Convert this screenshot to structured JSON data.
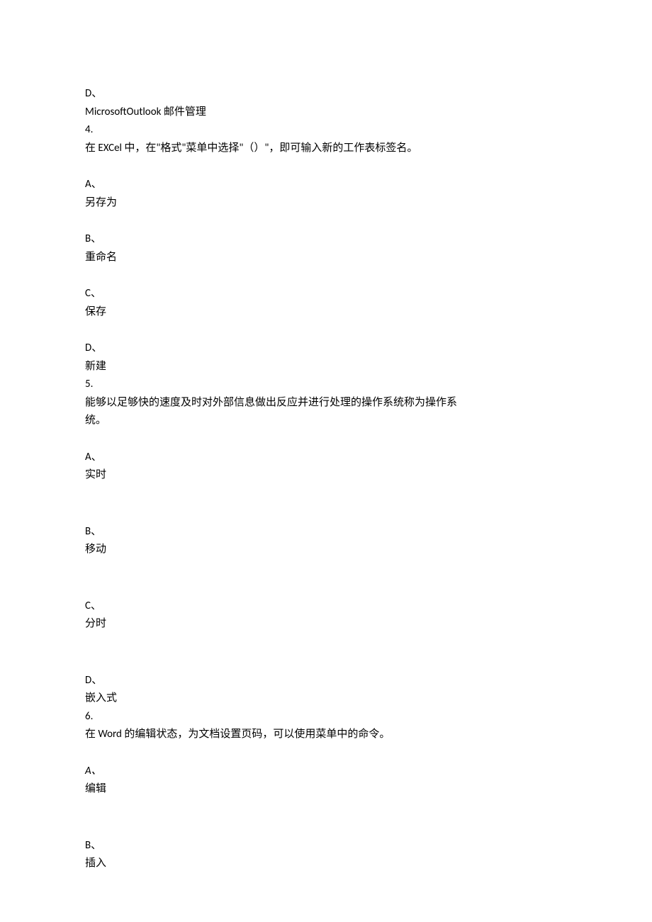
{
  "prev_option": {
    "letter": "D、",
    "text": "MicrosoftOutlook 邮件管理"
  },
  "q4": {
    "number": "4.",
    "stem": "在 EXCel 中，在\"格式\"菜单中选择\"（）\"，即可输入新的工作表标签名。",
    "options": {
      "a": {
        "letter": "A、",
        "text": "另存为"
      },
      "b": {
        "letter": "B、",
        "text": "重命名"
      },
      "c": {
        "letter": "C、",
        "text": "保存"
      },
      "d": {
        "letter": "D、",
        "text": "新建"
      }
    }
  },
  "q5": {
    "number": "5.",
    "stem_line1": "能够以足够快的速度及时对外部信息做出反应并进行处理的操作系统称为操作系",
    "stem_line2": "统。",
    "options": {
      "a": {
        "letter": "A、",
        "text": "实时"
      },
      "b": {
        "letter": "B、",
        "text": "移动"
      },
      "c": {
        "letter": "C、",
        "text": "分时"
      },
      "d": {
        "letter": "D、",
        "text": "嵌入式"
      }
    }
  },
  "q6": {
    "number": "6.",
    "stem": "在 Word 的编辑状态，为文档设置页码，可以使用菜单中的命令。",
    "options": {
      "a": {
        "letter": "A、",
        "text": "编辑"
      },
      "b": {
        "letter": "B、",
        "text": "插入"
      }
    }
  }
}
